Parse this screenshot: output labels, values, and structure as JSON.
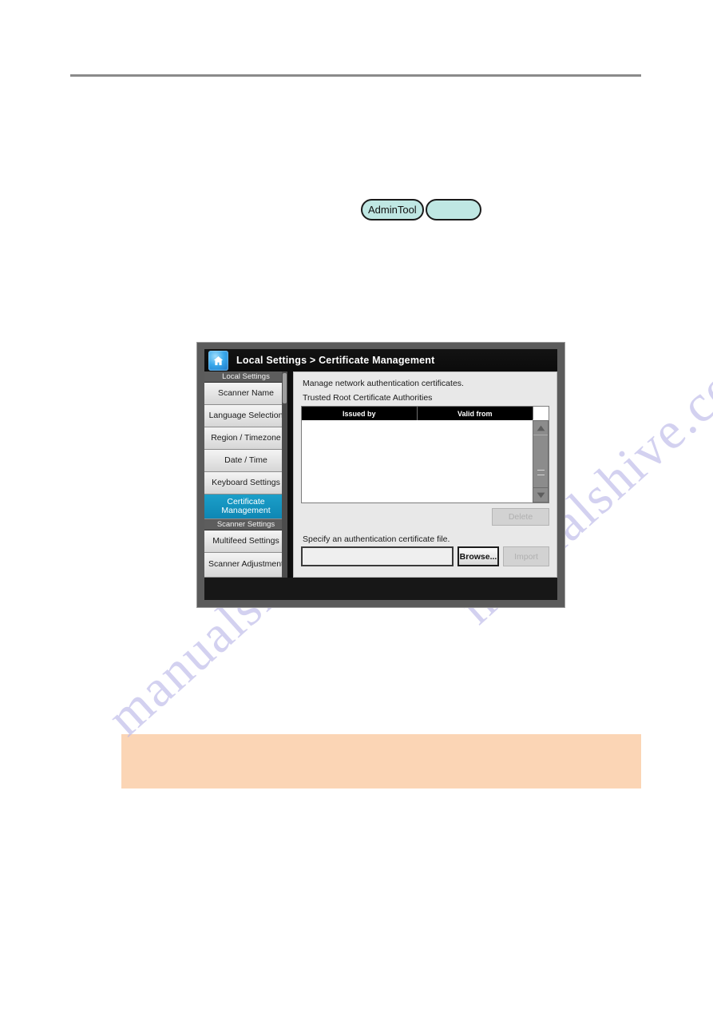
{
  "page": {
    "rule_present": true,
    "watermark": {
      "text_a": "manualshive.com",
      "text_b": "manualshive.com",
      "color": "#b9b6e8"
    },
    "callout": {
      "text": "",
      "background": "#fbd5b5"
    }
  },
  "pills": {
    "admin_tool_label": "AdminTool",
    "blank_label": "",
    "fill_color": "#bfe7e3",
    "border_color": "#1b1b1b"
  },
  "device": {
    "frame_color": "#5b5b5b",
    "titlebar": {
      "home_icon": "home-icon",
      "breadcrumb": "Local Settings > Certificate Management"
    },
    "sidebar": {
      "scroll": {
        "thumb_visible": true
      },
      "groups": [
        {
          "header": "Local Settings",
          "items": [
            {
              "label": "Scanner Name",
              "selected": false,
              "lines": 1
            },
            {
              "label": "Language Selection",
              "selected": false,
              "lines": 1
            },
            {
              "label": "Region / Timezone",
              "selected": false,
              "lines": 1
            },
            {
              "label": "Date / Time",
              "selected": false,
              "lines": 1
            },
            {
              "label": "Keyboard Settings",
              "selected": false,
              "lines": 1
            },
            {
              "label": "Certificate Management",
              "selected": true,
              "lines": 2
            }
          ]
        },
        {
          "header": "Scanner Settings",
          "items": [
            {
              "label": "Multifeed Settings",
              "selected": false,
              "lines": 1
            },
            {
              "label": "Scanner Adjustment",
              "selected": false,
              "lines": 2
            },
            {
              "label": "",
              "selected": false,
              "lines": 1,
              "clipped": true
            }
          ]
        }
      ]
    },
    "panel": {
      "description": "Manage network authentication certificates.",
      "section_label": "Trusted Root Certificate Authorities",
      "table": {
        "columns": [
          "Issued by",
          "Valid from"
        ],
        "rows": [],
        "scrollbar": {
          "up_arrow_icon": "triangle-up-icon",
          "down_arrow_icon": "triangle-down-icon",
          "grip_icon": "scrollbar-grip-icon"
        }
      },
      "delete_button": {
        "label": "Delete",
        "enabled": false
      },
      "file_section": {
        "instruction": "Specify an authentication certificate file.",
        "file_path_value": "",
        "file_path_placeholder": "",
        "browse_button": {
          "label": "Browse...",
          "enabled": true
        },
        "import_button": {
          "label": "Import",
          "enabled": false
        }
      }
    }
  }
}
